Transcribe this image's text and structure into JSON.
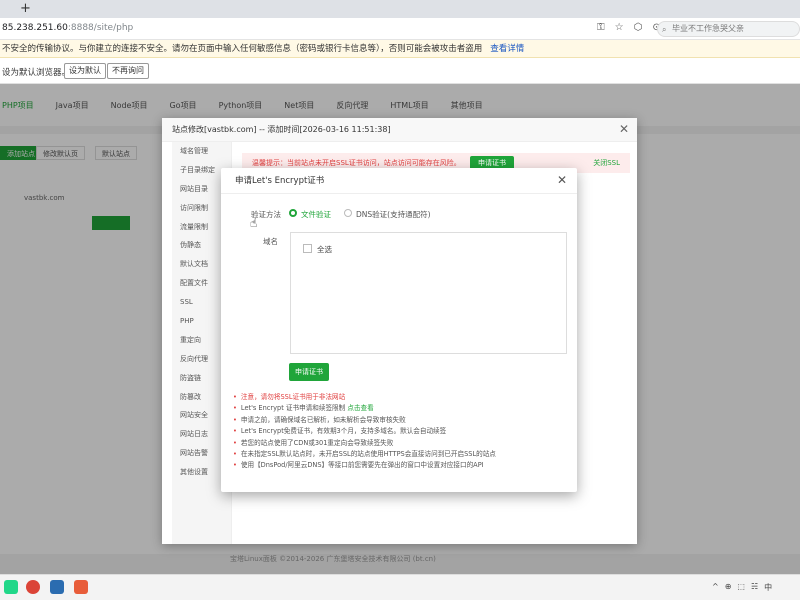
{
  "browser": {
    "url_host": "85.238.251.60",
    "url_path": ":8888/site/php",
    "search_placeholder": "毕业不工作急哭父亲",
    "icons": [
      "key-icon",
      "star-icon",
      "extensions-icon",
      "profile-icon"
    ]
  },
  "warning": {
    "text": "不安全的传输协议。与你建立的连接不安全。请勿在页面中输入任何敏感信息（密码或银行卡信息等），否则可能会被攻击者盗用",
    "link": "查看详情"
  },
  "default_bar": {
    "text": "设为默认浏览器。",
    "set_default": "设为默认",
    "dont_ask": "不再询问"
  },
  "page": {
    "nav": [
      "PHP项目",
      "Java项目",
      "Node项目",
      "Go项目",
      "Python项目",
      "Net项目",
      "反向代理",
      "HTML项目",
      "其他项目"
    ],
    "add_site": "添加站点",
    "modify_default": "修改默认页",
    "default_site": "默认站点",
    "site_name": "vastbk.com",
    "footer": "宝塔Linux面板 ©2014-2026 广东堡塔安全技术有限公司 (bt.cn)"
  },
  "site_dialog": {
    "title": "站点修改[vastbk.com] -- 添加时间[2026-03-16 11:51:38]",
    "menu": [
      "域名管理",
      "子目录绑定",
      "网站目录",
      "访问限制",
      "流量限制",
      "伪静态",
      "默认文档",
      "配置文件",
      "SSL",
      "PHP",
      "重定向",
      "反向代理",
      "防盗链",
      "防篡改",
      "网站安全",
      "网站日志",
      "网站告警",
      "其他设置"
    ],
    "notice": "温馨提示：当前站点未开启SSL证书访问，站点访问可能存在风险。",
    "apply": "申请证书",
    "close_ssl": "关闭SSL"
  },
  "le_dialog": {
    "title": "申请Let's Encrypt证书",
    "verify_label": "验证方法",
    "option_file": "文件验证",
    "option_dns": "DNS验证(支持通配符)",
    "domain_label": "域名",
    "select_all": "全选",
    "apply_button": "申请证书",
    "notes": [
      {
        "text": "注意，请勿将SSL证书用于非法网站",
        "red": true
      },
      {
        "text": "Let's Encrypt 证书申请和续签限制 ",
        "link": "点击查看"
      },
      {
        "text": "申请之前，请确保域名已解析，如未解析会导致审核失败"
      },
      {
        "text": "Let's Encrypt免费证书，有效期3个月，支持多域名。默认会自动续签"
      },
      {
        "text": "若您的站点使用了CDN或301重定向会导致续签失败"
      },
      {
        "text": "在未指定SSL默认站点时，未开启SSL的站点使用HTTPS会直接访问到已开启SSL的站点"
      },
      {
        "text": "使用【DnsPod/阿里云DNS】等接口前您需要先在弹出的窗口中设置对应接口的API"
      }
    ]
  },
  "taskbar": {
    "apps": [
      {
        "icon": "pycharm-icon",
        "color": "#21d789"
      },
      {
        "icon": "chrome-icon",
        "color": "#db4437"
      },
      {
        "icon": "notepad-icon",
        "color": "#2b6cb0"
      },
      {
        "icon": "clion-icon",
        "color": "#e85d3a"
      }
    ],
    "tray": [
      "^",
      "⊕",
      "⬚",
      "☵",
      "中"
    ]
  }
}
